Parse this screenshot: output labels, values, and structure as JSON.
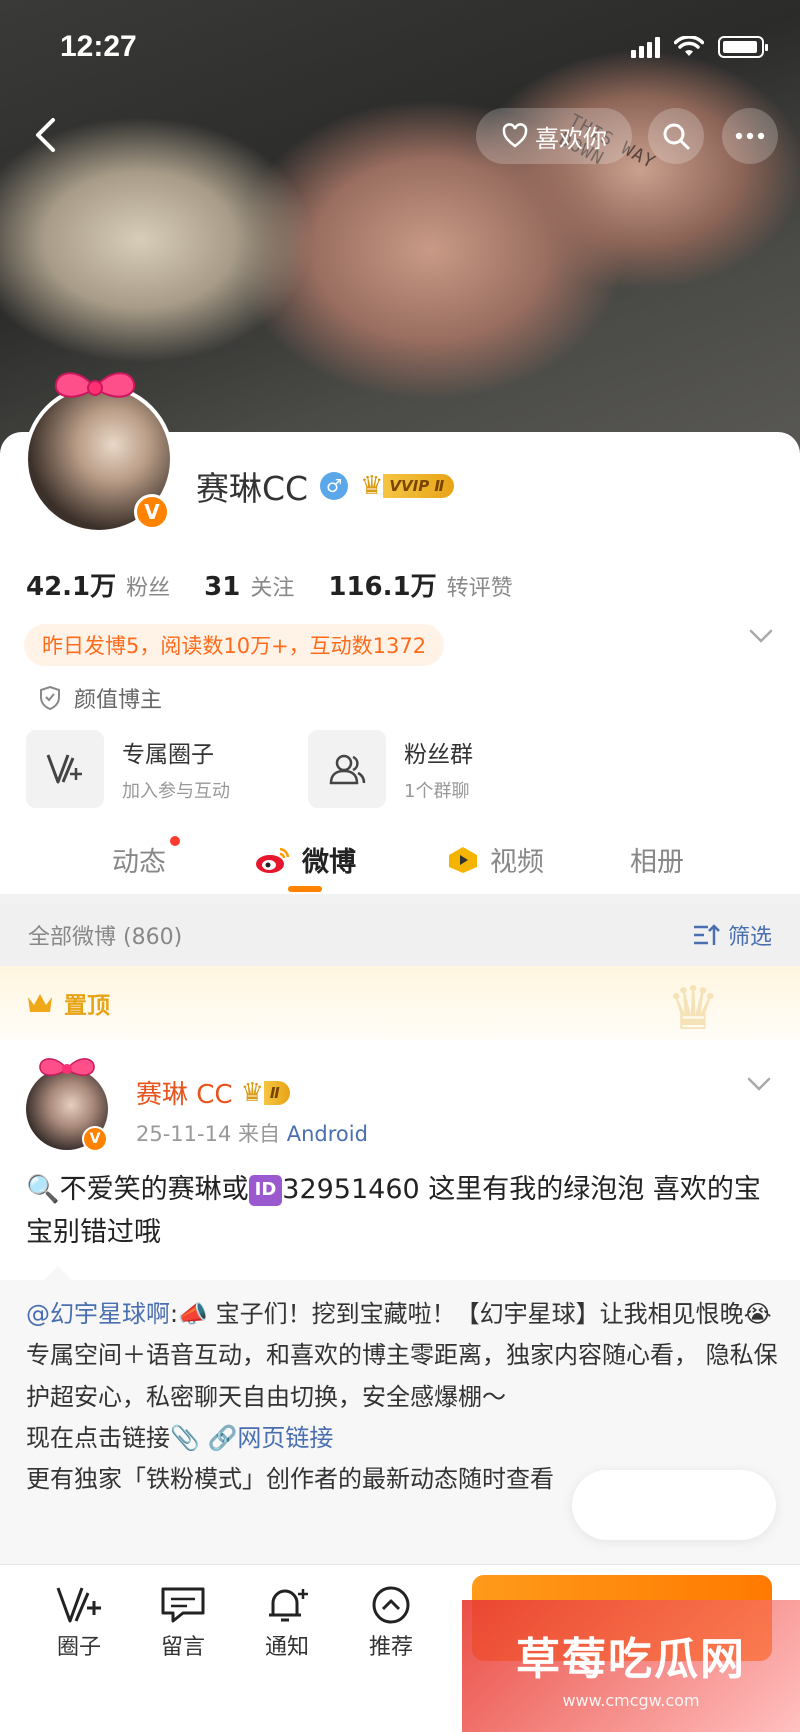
{
  "status_bar": {
    "time": "12:27"
  },
  "nav": {
    "like_label": "喜欢你"
  },
  "profile": {
    "name": "赛琳CC",
    "gender_icon": "♂",
    "vip_label": "VVIP Ⅱ",
    "stats": [
      {
        "value": "42.1万",
        "label": "粉丝"
      },
      {
        "value": "31",
        "label": "关注"
      },
      {
        "value": "116.1万",
        "label": "转评赞"
      }
    ],
    "highlight": "昨日发博5，阅读数10万+，互动数1372",
    "tag": "颜值博主",
    "cards": [
      {
        "title": "专属圈子",
        "subtitle": "加入参与互动"
      },
      {
        "title": "粉丝群",
        "subtitle": "1个群聊"
      }
    ],
    "tabs": [
      "动态",
      "微博",
      "视频",
      "相册"
    ],
    "active_tab": "微博"
  },
  "filter": {
    "count_label": "全部微博 (860)",
    "filter_label": "筛选"
  },
  "pinned": {
    "label": "置顶"
  },
  "post": {
    "author": "赛琳 CC",
    "vip_level": "Ⅱ",
    "date": "25-11-14",
    "source_prefix": "来自",
    "source": "Android",
    "text_part1": "不爱笑的赛琳或",
    "id_badge": "ID",
    "text_part2": "32951460 这里有我的绿泡泡 喜欢的宝宝别错过哦"
  },
  "repost": {
    "mention": "@幻宇星球啊",
    "line1": ":📣 宝子们！挖到宝藏啦！【幻宇星球】让我相见恨晚😭 专属空间＋语音互动，和喜欢的博主零距离，独家内容随心看， 隐私保护超安心，私密聊天自由切换，安全感爆棚～",
    "line2_prefix": "现在点击链接📎 ",
    "link": "网页链接",
    "line3": "更有独家「铁粉模式」创作者的最新动态随时查看"
  },
  "bottom_bar": {
    "items": [
      {
        "label": "圈子",
        "icon": "v-plus-icon"
      },
      {
        "label": "留言",
        "icon": "message-icon"
      },
      {
        "label": "通知",
        "icon": "bell-plus-icon"
      },
      {
        "label": "推荐",
        "icon": "chevron-up-circle-icon"
      }
    ]
  },
  "watermark": {
    "title": "草莓吃瓜网",
    "url": "www.cmcgw.com"
  },
  "colors": {
    "accent": "#ff8200",
    "link": "#4a6fb0",
    "highlight_text": "#ff6b1a",
    "gold": "#e8a417"
  }
}
